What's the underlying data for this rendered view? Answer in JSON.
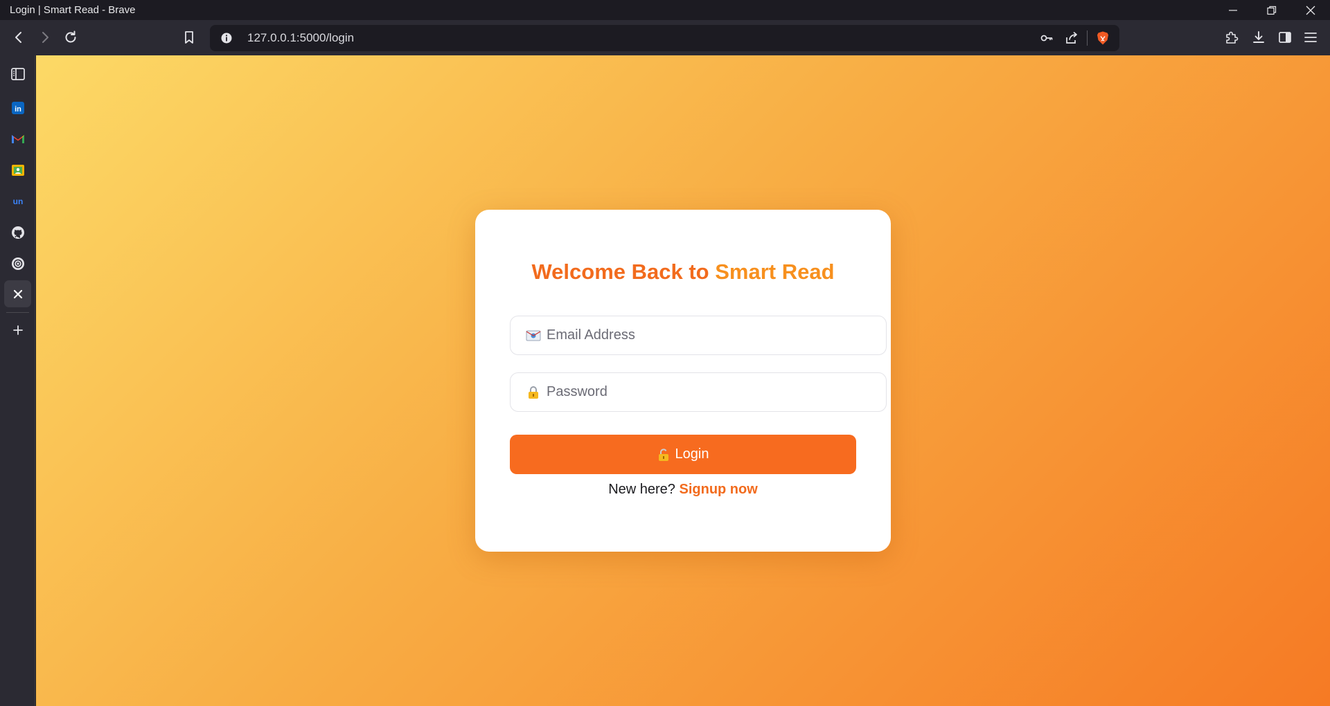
{
  "window": {
    "title": "Login | Smart Read - Brave"
  },
  "toolbar": {
    "url": "127.0.0.1:5000/login",
    "icons": [
      "back-icon",
      "forward-icon",
      "reload-icon",
      "bookmark-icon",
      "site-info-icon",
      "key-icon",
      "share-icon",
      "brave-shields-icon",
      "extensions-icon",
      "download-icon",
      "sidebar-toggle-icon",
      "menu-icon"
    ]
  },
  "sidebar": {
    "items": [
      "sidebar-panel-icon",
      "linkedin-icon",
      "gmail-icon",
      "contacts-icon",
      "unstop-icon",
      "github-icon",
      "chatgpt-icon",
      "x-icon",
      "add-icon"
    ]
  },
  "login": {
    "title_prefix": "Welcome Back to ",
    "title_brand": "Smart Read",
    "email_placeholder": "Email Address",
    "password_placeholder": "Password",
    "button_label": "Login",
    "signup_prompt": "New here? ",
    "signup_link": "Signup now"
  },
  "colors": {
    "accent": "#f76b1f",
    "brand": "#f7901e",
    "gradient_start": "#fcd966",
    "gradient_end": "#f67a24"
  }
}
